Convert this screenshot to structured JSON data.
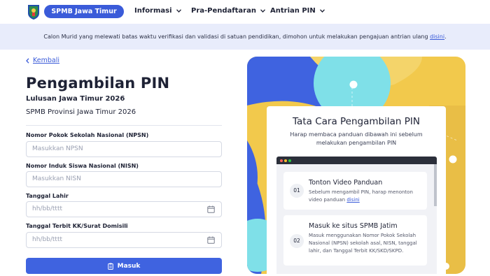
{
  "header": {
    "brand": "SPMB Jawa Timur",
    "nav": [
      "Informasi",
      "Pra-Pendaftaran",
      "Antrian PIN"
    ]
  },
  "banner": {
    "text": "Calon Murid yang melewati batas waktu verifikasi dan validasi di satuan pendidikan, dimohon untuk melakukan pengajuan antrian ulang",
    "link": "disini",
    "end": "."
  },
  "form": {
    "back": "Kembali",
    "title": "Pengambilan PIN",
    "subtitle": "Lulusan Jawa Timur 2026",
    "org": "SPMB Provinsi Jawa Timur 2026",
    "fields": [
      {
        "label": "Nomor Pokok Sekolah Nasional (NPSN)",
        "placeholder": "Masukkan NPSN"
      },
      {
        "label": "Nomor Induk Siswa Nasional (NISN)",
        "placeholder": "Masukkan NISN"
      },
      {
        "label": "Tanggal Lahir",
        "placeholder": "hh/bb/tttt"
      },
      {
        "label": "Tanggal Terbit KK/Surat Domisili",
        "placeholder": "hh/bb/tttt"
      }
    ],
    "submit": "Masuk"
  },
  "guide": {
    "title": "Tata Cara Pengambilan PIN",
    "subtitle": "Harap membaca panduan dibawah ini sebelum melakukan pengambilan PIN",
    "steps": [
      {
        "num": "01",
        "title": "Tonton Video Panduan",
        "desc": "Sebelum mengambil PIN, harap menonton video panduan",
        "link": "disini"
      },
      {
        "num": "02",
        "title": "Masuk ke situs SPMB Jatim",
        "desc": "Masuk menggunakan Nomor Pokok Sekolah Nasional (NPSN) sekolah asal, NISN, tanggal lahir, dan Tanggal Terbit KK/SKD/SKPD."
      }
    ]
  },
  "colors": {
    "primary": "#3f63e0",
    "accent_yellow": "#f2c94c",
    "accent_cyan": "#7fe0e8"
  }
}
